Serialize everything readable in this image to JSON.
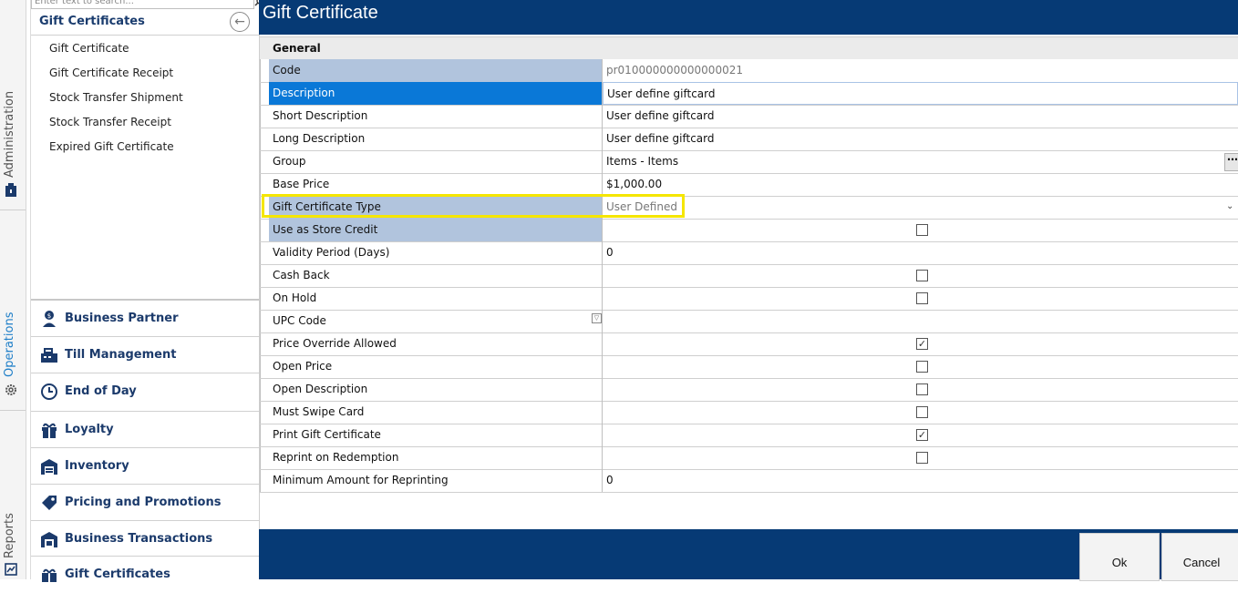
{
  "sidebar_tabs": [
    {
      "label": "Administration",
      "icon": "administration-icon"
    },
    {
      "label": "Operations",
      "icon": "gear-icon",
      "color": "#1e7ec8"
    },
    {
      "label": "Reports",
      "icon": "reports-icon"
    }
  ],
  "nav": {
    "search_placeholder": "Enter text to search...",
    "section_title": "Gift Certificates",
    "sub_items": [
      "Gift Certificate",
      "Gift Certificate Receipt",
      "Stock Transfer Shipment",
      "Stock Transfer Receipt",
      "Expired Gift Certificate"
    ],
    "modules": [
      {
        "label": "Business Partner",
        "icon": "business-partner-icon"
      },
      {
        "label": "Till Management",
        "icon": "till-icon"
      },
      {
        "label": "End of Day",
        "icon": "clock-icon"
      },
      {
        "label": "Loyalty",
        "icon": "gift-icon"
      },
      {
        "label": "Inventory",
        "icon": "warehouse-icon"
      },
      {
        "label": "Pricing and Promotions",
        "icon": "pricing-icon"
      },
      {
        "label": "Business Transactions",
        "icon": "transactions-icon"
      },
      {
        "label": "Gift Certificates",
        "icon": "gift-certificate-icon"
      }
    ]
  },
  "form": {
    "title": "Gift Certificate",
    "group_label": "General",
    "fields": [
      {
        "label": "Code",
        "value": "pr010000000000000021"
      },
      {
        "label": "Description",
        "value": "User define giftcard"
      },
      {
        "label": "Short Description",
        "value": "User define giftcard"
      },
      {
        "label": "Long Description",
        "value": "User define giftcard"
      },
      {
        "label": "Group",
        "value": "Items - Items"
      },
      {
        "label": "Base Price",
        "value": "$1,000.00"
      },
      {
        "label": "Gift Certificate Type",
        "value": "User Defined"
      },
      {
        "label": "Use as Store Credit",
        "checked": false
      },
      {
        "label": "Validity Period (Days)",
        "value": "0"
      },
      {
        "label": "Cash Back",
        "checked": false
      },
      {
        "label": "On Hold",
        "checked": false
      },
      {
        "label": "UPC Code",
        "value": ""
      },
      {
        "label": "Price Override Allowed",
        "checked": true
      },
      {
        "label": "Open Price",
        "checked": false
      },
      {
        "label": "Open Description",
        "checked": false
      },
      {
        "label": "Must Swipe Card",
        "checked": false
      },
      {
        "label": "Print Gift Certificate",
        "checked": true
      },
      {
        "label": "Reprint on Redemption",
        "checked": false
      },
      {
        "label": "Minimum Amount for Reprinting",
        "value": "0"
      }
    ]
  },
  "footer": {
    "ok_label": "Ok",
    "cancel_label": "Cancel"
  },
  "colors": {
    "brand": "#063a75",
    "selected_row": "#0a78d7",
    "label_highlight": "#b1c4dd",
    "callout": "#f5e600"
  }
}
